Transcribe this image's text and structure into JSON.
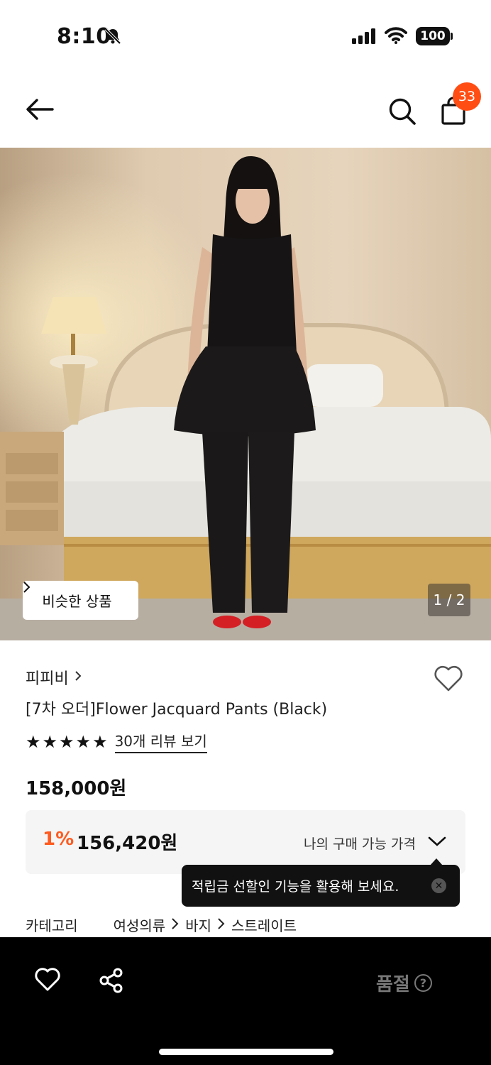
{
  "status": {
    "time": "8:10",
    "battery": "100"
  },
  "header": {
    "cart_count": "33"
  },
  "hero": {
    "similar_label": "비슷한 상품",
    "page_indicator": "1 / 2"
  },
  "product": {
    "brand": "피피비",
    "title": "[7차 오더]Flower Jacquard Pants (Black)",
    "rating_stars": 5,
    "review_link": "30개 리뷰 보기",
    "price": "158,000원"
  },
  "my_price": {
    "discount": "1%",
    "price": "156,420원",
    "label": "나의 구매 가능 가격"
  },
  "tooltip": {
    "text": "적립금 선할인 기능을 활용해 보세요."
  },
  "category": {
    "label": "카테고리",
    "path": [
      "여성의류",
      "바지",
      "스트레이트"
    ]
  },
  "bottom_bar": {
    "status": "품절",
    "help": "?"
  },
  "colors": {
    "accent": "#ff4d14",
    "discount": "#ff5a1f"
  }
}
